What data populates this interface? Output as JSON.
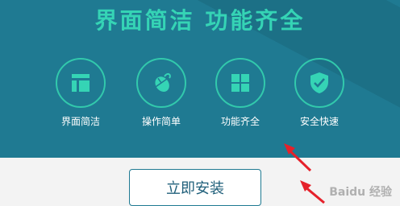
{
  "banner": {
    "headline": "界面简洁  功能齐全",
    "features": [
      {
        "label": "界面简洁",
        "icon": "layout-icon"
      },
      {
        "label": "操作简单",
        "icon": "mouse-icon"
      },
      {
        "label": "功能齐全",
        "icon": "grid-icon"
      },
      {
        "label": "安全快速",
        "icon": "shield-check-icon"
      }
    ]
  },
  "footer": {
    "install_label": "立即安装"
  },
  "watermark": "Baidu 经验",
  "colors": {
    "banner_bg": "#1f7a92",
    "accent": "#32c9ac",
    "arrow": "#e5212b"
  }
}
